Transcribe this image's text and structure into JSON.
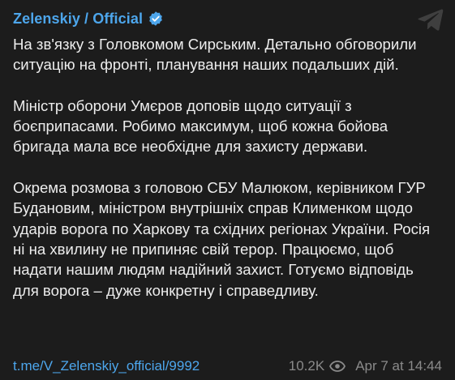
{
  "channel": {
    "name": "Zelenskiy / Official",
    "verified": true
  },
  "message": {
    "paragraphs": [
      "На зв'язку з Головкомом Сирським. Детально обговорили ситуацію на фронті, планування наших подальших дій.",
      "Міністр оборони Умєров доповів щодо ситуації з боєприпасами. Робимо максимум, щоб кожна бойова бригада мала все необхідне для захисту держави.",
      "Окрема розмова з головою СБУ Малюком, керівником ГУР Будановим, міністром внутрішніх справ Клименком щодо ударів ворога по Харкову та східних регіонах України. Росія ні на хвилину не припиняє свій терор. Працюємо, щоб надати нашим людям надійний захист. Готуємо відповідь для ворога – дуже конкретну і справедливу."
    ]
  },
  "footer": {
    "link": "t.me/V_Zelenskiy_official/9992",
    "views": "10.2K",
    "timestamp": "Apr 7 at 14:44"
  },
  "icons": {
    "verified": "verified-badge-icon",
    "telegram": "telegram-logo-icon",
    "views": "eye-icon"
  },
  "colors": {
    "background": "#1c1c1c",
    "accent": "#4da6ec",
    "text": "#ededed",
    "muted": "#8a8a8a",
    "telegram_logo": "#3f3f3f"
  }
}
